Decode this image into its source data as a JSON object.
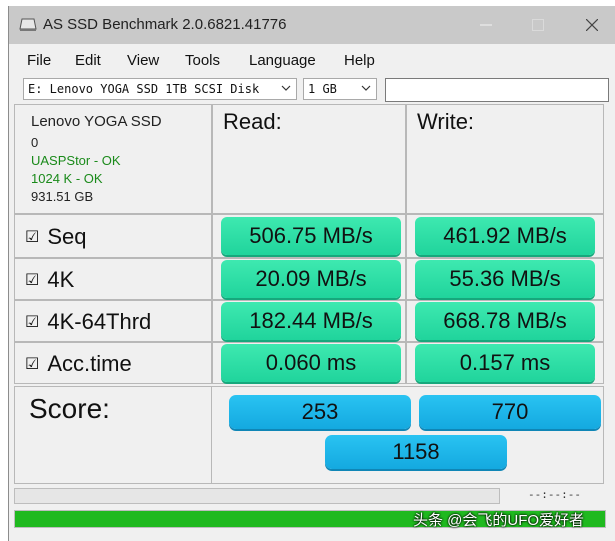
{
  "window": {
    "title": "AS SSD Benchmark 2.0.6821.41776"
  },
  "menu": [
    "File",
    "Edit",
    "View",
    "Tools",
    "Language",
    "Help"
  ],
  "toolbar": {
    "drive_select": "E: Lenovo YOGA SSD 1TB SCSI Disk",
    "size_select": "1 GB",
    "text_input": ""
  },
  "drive_info": {
    "name": "Lenovo YOGA SSD",
    "line2": "0",
    "driver": "UASPStor - OK",
    "alignment": "1024 K - OK",
    "capacity": "931.51 GB"
  },
  "headers": {
    "read": "Read:",
    "write": "Write:"
  },
  "tests": [
    {
      "check": "☑",
      "label": "Seq",
      "read": "506.75 MB/s",
      "write": "461.92 MB/s"
    },
    {
      "check": "☑",
      "label": "4K",
      "read": "20.09 MB/s",
      "write": "55.36 MB/s"
    },
    {
      "check": "☑",
      "label": "4K-64Thrd",
      "read": "182.44 MB/s",
      "write": "668.78 MB/s"
    },
    {
      "check": "☑",
      "label": "Acc.time",
      "read": "0.060 ms",
      "write": "0.157 ms"
    }
  ],
  "score": {
    "label": "Score:",
    "read": "253",
    "write": "770",
    "total": "1158"
  },
  "status": {
    "time": "--:--:--",
    "progress_fraction": 1.0
  },
  "watermark": "头条 @会飞的UFO爱好者",
  "colors": {
    "result_green": "#2ee0a6",
    "score_blue": "#1eb6ea",
    "progress_green": "#1fb91f",
    "ok_text": "#1a8a1a"
  }
}
